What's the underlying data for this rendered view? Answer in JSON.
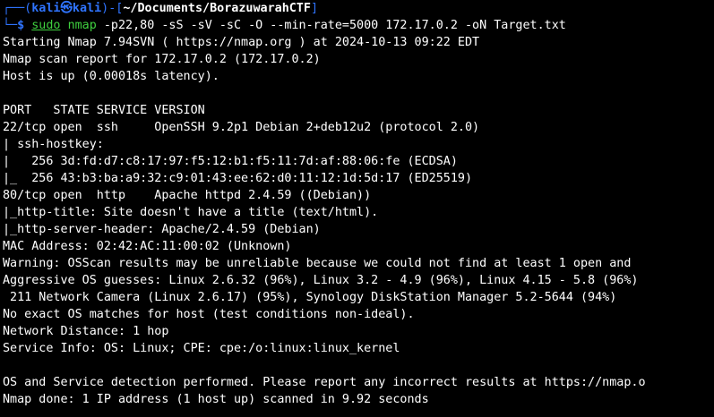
{
  "prompt": {
    "frame_top": "┌──(",
    "user": "kali",
    "at_symbol": "㉿",
    "host": "kali",
    "sep": ")-[",
    "path": "~/Documents/BorazuwarahCTF",
    "close": "]",
    "frame_bottom": "└─",
    "dollar": "$ ",
    "sudo": "sudo",
    "command": "nmap",
    "args": " -p22,80 -sS -sV -sC -O --min-rate=5000 172.17.0.2 -oN Target.txt"
  },
  "output_lines": [
    "Starting Nmap 7.94SVN ( https://nmap.org ) at 2024-10-13 09:22 EDT",
    "Nmap scan report for 172.17.0.2 (172.17.0.2)",
    "Host is up (0.00018s latency).",
    "",
    "PORT   STATE SERVICE VERSION",
    "22/tcp open  ssh     OpenSSH 9.2p1 Debian 2+deb12u2 (protocol 2.0)",
    "| ssh-hostkey:",
    "|   256 3d:fd:d7:c8:17:97:f5:12:b1:f5:11:7d:af:88:06:fe (ECDSA)",
    "|_  256 43:b3:ba:a9:32:c9:01:43:ee:62:d0:11:12:1d:5d:17 (ED25519)",
    "80/tcp open  http    Apache httpd 2.4.59 ((Debian))",
    "|_http-title: Site doesn't have a title (text/html).",
    "|_http-server-header: Apache/2.4.59 (Debian)",
    "MAC Address: 02:42:AC:11:00:02 (Unknown)",
    "Warning: OSScan results may be unreliable because we could not find at least 1 open and",
    "Aggressive OS guesses: Linux 2.6.32 (96%), Linux 3.2 - 4.9 (96%), Linux 4.15 - 5.8 (96%)",
    " 211 Network Camera (Linux 2.6.17) (95%), Synology DiskStation Manager 5.2-5644 (94%)",
    "No exact OS matches for host (test conditions non-ideal).",
    "Network Distance: 1 hop",
    "Service Info: OS: Linux; CPE: cpe:/o:linux:linux_kernel",
    "",
    "OS and Service detection performed. Please report any incorrect results at https://nmap.o",
    "Nmap done: 1 IP address (1 host up) scanned in 9.92 seconds"
  ],
  "colors": {
    "background": "#000000",
    "text": "#ffffff",
    "prompt_blue": "#2f74ff",
    "command_green": "#3fd13f"
  }
}
